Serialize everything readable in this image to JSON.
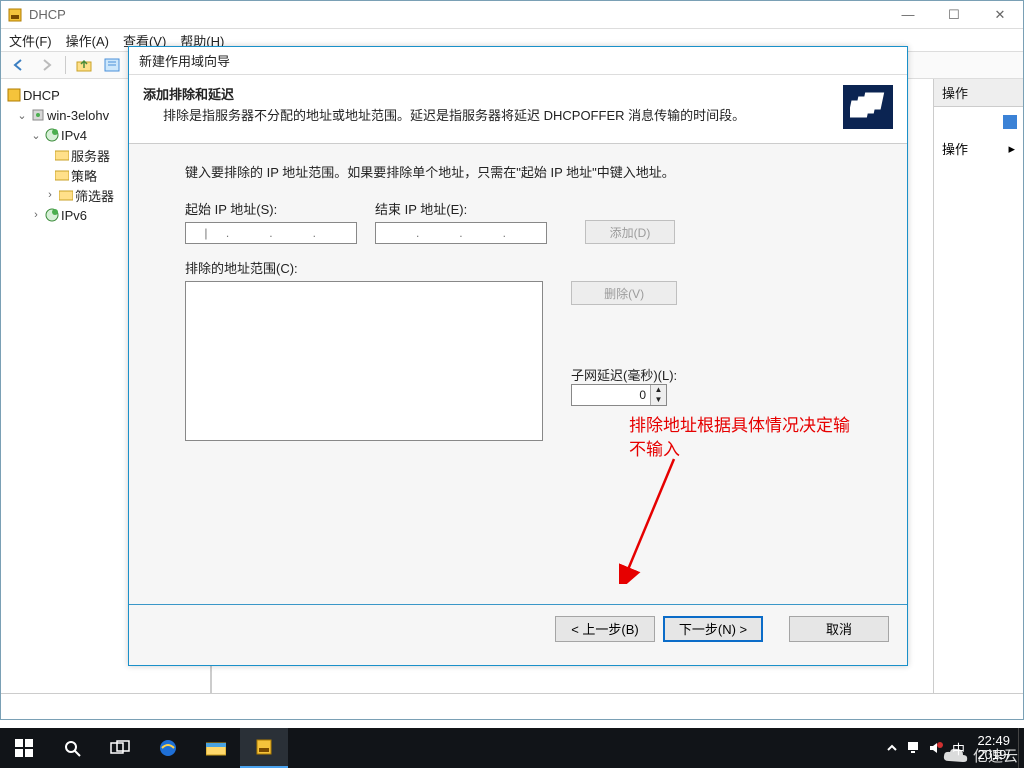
{
  "window": {
    "title": "DHCP",
    "menu": {
      "file": "文件(F)",
      "action": "操作(A)",
      "view": "查看(V)",
      "help": "帮助(H)"
    }
  },
  "tree": {
    "root": "DHCP",
    "server": "win-3elohv",
    "ipv4": "IPv4",
    "server_opts": "服务器",
    "policy": "策略",
    "filter": "筛选器",
    "ipv6": "IPv6"
  },
  "actions_pane": {
    "header": "操作",
    "more": "操作"
  },
  "wizard": {
    "title": "新建作用域向导",
    "heading": "添加排除和延迟",
    "subheading": "排除是指服务器不分配的地址或地址范围。延迟是指服务器将延迟 DHCPOFFER 消息传输的时间段。",
    "instruction": "键入要排除的 IP 地址范围。如果要排除单个地址，只需在\"起始 IP 地址\"中键入地址。",
    "start_ip_label": "起始 IP 地址(S):",
    "end_ip_label": "结束 IP 地址(E):",
    "add_btn": "添加(D)",
    "excluded_label": "排除的地址范围(C):",
    "delete_btn": "删除(V)",
    "delay_label": "子网延迟(毫秒)(L):",
    "delay_value": "0",
    "back": "< 上一步(B)",
    "next": "下一步(N) >",
    "cancel": "取消"
  },
  "annotation": {
    "line1": "排除地址根据具体情况决定输",
    "line2": "不输入"
  },
  "taskbar": {
    "time": "22:49",
    "date": "2019/"
  },
  "watermark": "亿速云"
}
